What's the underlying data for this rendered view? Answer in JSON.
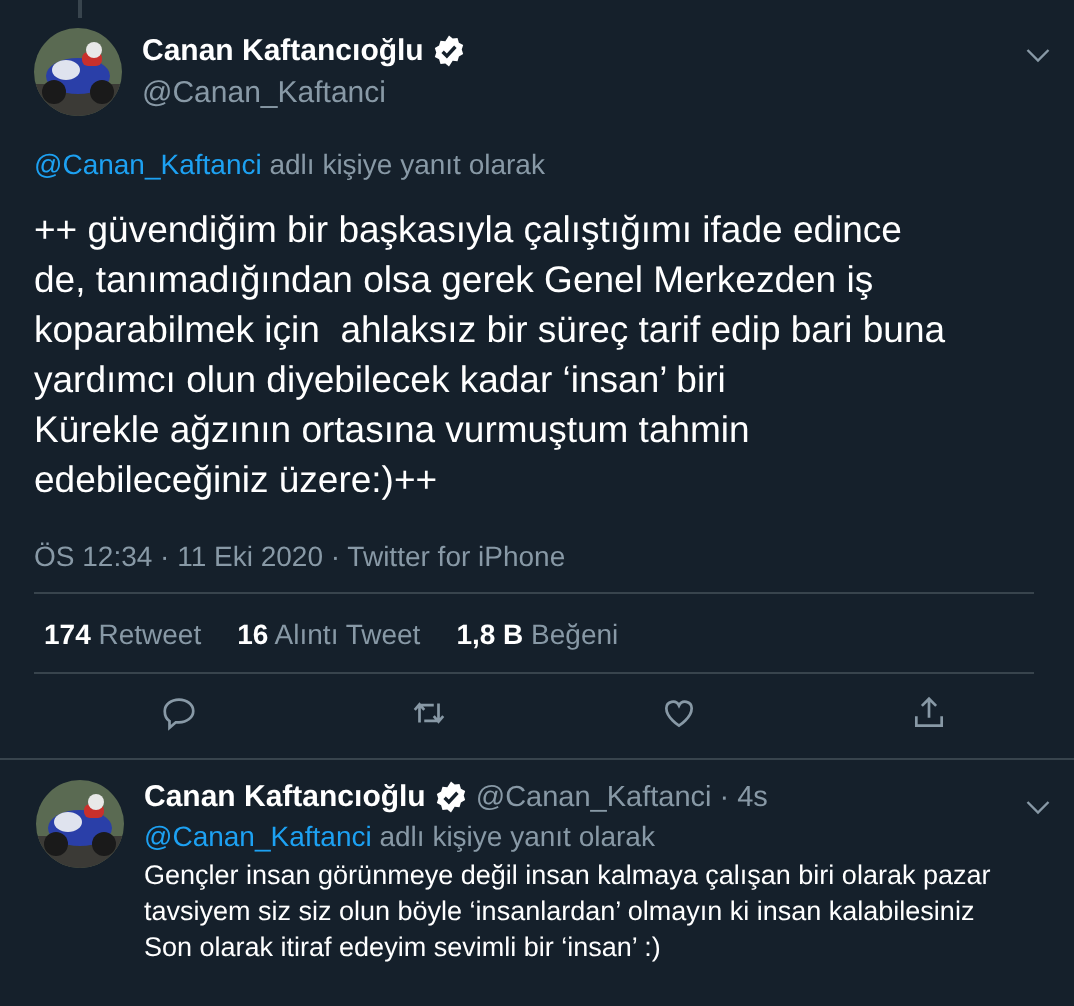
{
  "main_tweet": {
    "author": {
      "name": "Canan Kaftancıoğlu",
      "verified": true,
      "handle": "@Canan_Kaftanci"
    },
    "reply_to": {
      "handle": "@Canan_Kaftanci",
      "text": "adlı kişiye yanıt olarak"
    },
    "text_lines": [
      "++ güvendiğim bir başkasıyla çalıştığımı ifade edince",
      "de, tanımadığından olsa gerek Genel Merkezden iş",
      "koparabilmek için  ahlaksız bir süreç tarif edip bari buna",
      "yardımcı olun diyebilecek kadar ‘insan’ biri",
      "Kürekle ağzının ortasına vurmuştum tahmin",
      "edebileceğiniz üzere:)++"
    ],
    "meta": "ÖS 12:34 · 11 Eki 2020 · Twitter for iPhone",
    "stats": [
      {
        "count": "174",
        "label": "Retweet"
      },
      {
        "count": "16",
        "label": "Alıntı Tweet"
      },
      {
        "count": "1,8 B",
        "label": "Beğeni"
      }
    ],
    "actions": [
      {
        "kind": "reply"
      },
      {
        "kind": "retweet"
      },
      {
        "kind": "like"
      },
      {
        "kind": "share"
      }
    ]
  },
  "reply_tweet": {
    "author": {
      "name": "Canan Kaftancıoğlu",
      "verified": true,
      "handle": "@Canan_Kaftanci",
      "time": "· 4s"
    },
    "reply_to": {
      "handle": "@Canan_Kaftanci",
      "text": "adlı kişiye yanıt olarak"
    },
    "text_lines": [
      "Gençler insan görünmeye değil insan kalmaya çalışan biri olarak pazar",
      "tavsiyem siz siz olun böyle ‘insanlardan’ olmayın ki insan kalabilesiniz",
      "Son olarak itiraf edeyim sevimli bir ‘insan’ :)"
    ]
  }
}
